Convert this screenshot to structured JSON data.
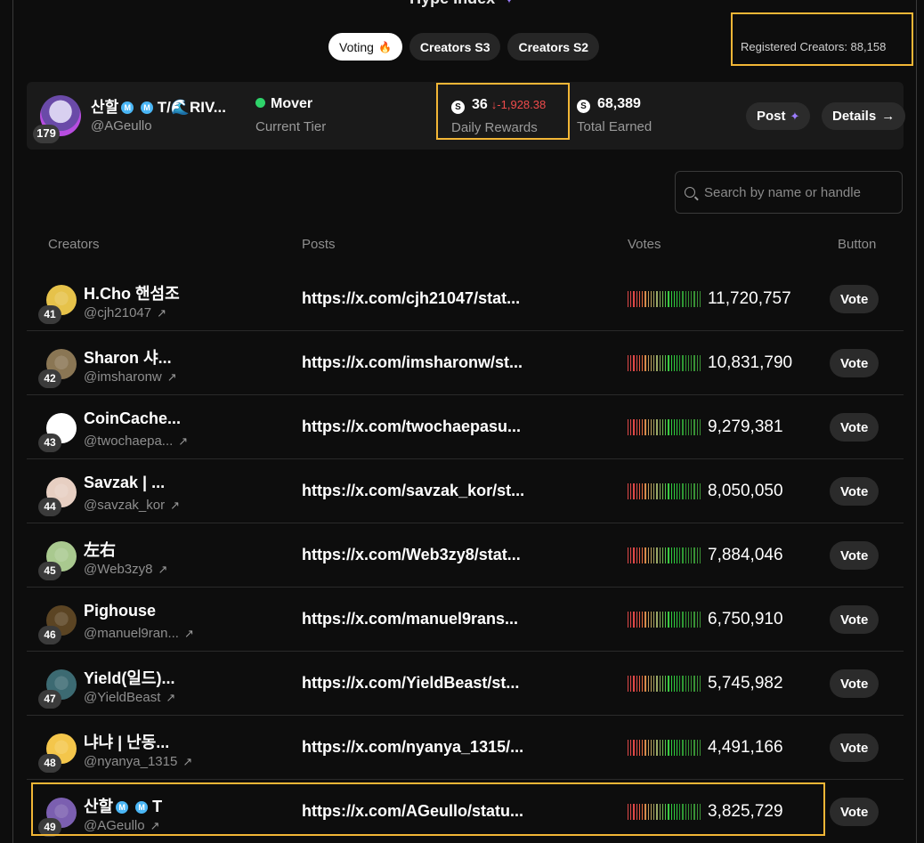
{
  "page": {
    "title": "Hype Index"
  },
  "tabs": [
    {
      "label": "Voting",
      "active": true
    },
    {
      "label": "Creators S3",
      "active": false
    },
    {
      "label": "Creators S2",
      "active": false
    }
  ],
  "registered": "Registered Creators: 88,158",
  "profile": {
    "name": "산할",
    "name_suffix": "T/🌊RIV...",
    "handle": "@AGeullo",
    "rank": "179",
    "tier": "Mover",
    "tier_label": "Current Tier",
    "daily_rewards": "36",
    "daily_delta": "↓-1,928.38",
    "daily_label": "Daily Rewards",
    "total_earned": "68,389",
    "total_label": "Total Earned",
    "post_label": "Post",
    "details_label": "Details",
    "details_arrow": "→"
  },
  "search": {
    "placeholder": "Search by name or handle"
  },
  "table": {
    "headers": {
      "creators": "Creators",
      "posts": "Posts",
      "votes": "Votes",
      "button": "Button"
    },
    "vote_label": "Vote",
    "rows": [
      {
        "rank": "41",
        "name": "H.Cho 핸섬조",
        "handle": "@cjh21047",
        "post": "https://x.com/cjh21047/stat...",
        "votes": "11,720,757",
        "avatar_color": "#e6c24a"
      },
      {
        "rank": "42",
        "name": "Sharon 샤...",
        "handle": "@imsharonw",
        "post": "https://x.com/imsharonw/st...",
        "votes": "10,831,790",
        "avatar_color": "#8a7654"
      },
      {
        "rank": "43",
        "name": "CoinCache...",
        "handle": "@twochaepa...",
        "post": "https://x.com/twochaepasu...",
        "votes": "9,279,381",
        "avatar_color": "#ffffff"
      },
      {
        "rank": "44",
        "name": "Savzak | ...",
        "handle": "@savzak_kor",
        "post": "https://x.com/savzak_kor/st...",
        "votes": "8,050,050",
        "avatar_color": "#e7cfc2"
      },
      {
        "rank": "45",
        "name": "左右",
        "handle": "@Web3zy8",
        "post": "https://x.com/Web3zy8/stat...",
        "votes": "7,884,046",
        "avatar_color": "#a9c98f"
      },
      {
        "rank": "46",
        "name": "Pighouse",
        "handle": "@manuel9ran...",
        "post": "https://x.com/manuel9rans...",
        "votes": "6,750,910",
        "avatar_color": "#5b4423"
      },
      {
        "rank": "47",
        "name": "Yield(일드)...",
        "handle": "@YieldBeast",
        "post": "https://x.com/YieldBeast/st...",
        "votes": "5,745,982",
        "avatar_color": "#3c6a72"
      },
      {
        "rank": "48",
        "name": "냐냐 | 난동...",
        "handle": "@nyanya_1315",
        "post": "https://x.com/nyanya_1315/...",
        "votes": "4,491,166",
        "avatar_color": "#f4c64b"
      },
      {
        "rank": "49",
        "name": "산할",
        "name_suffix": "T",
        "handle": "@AGeullo",
        "post": "https://x.com/AGeullo/statu...",
        "votes": "3,825,729",
        "avatar_color": "#7b5fb0"
      }
    ]
  },
  "colors": {
    "highlight": "#f2b636",
    "accent_purple": "#9b7cff",
    "negative": "#ef4b4b",
    "tier_green": "#2ed36a",
    "verified_blue": "#4ab6f5"
  },
  "icons": {
    "spark": "sparkle-icon",
    "fire": "fire-icon",
    "token": "token-icon",
    "external": "external-link-icon",
    "search": "search-icon"
  }
}
